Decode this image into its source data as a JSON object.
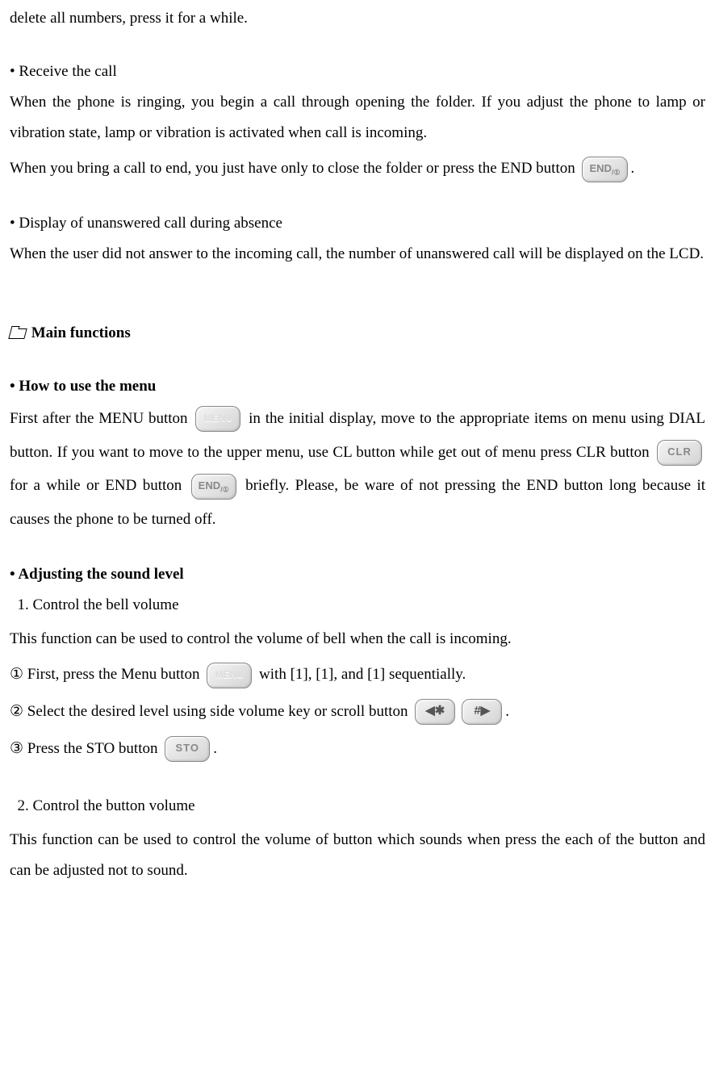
{
  "intro_delete": "delete all numbers, press it for a while.",
  "receive": {
    "head": "• Receive the call",
    "p1": "When the phone is ringing, you begin a call through opening the folder. If you adjust the phone to lamp or vibration state, lamp or vibration is activated when call is incoming.",
    "p2a": "When you bring a call to end, you just have only to close the folder or press the END button ",
    "p2b": "."
  },
  "unanswered": {
    "head": "• Display of unanswered call during absence",
    "p1": "When the user did not answer to the incoming call, the number of unanswered call will be displayed on the LCD."
  },
  "main_functions_head": " Main functions",
  "menu": {
    "head": "• How to use the menu",
    "p1a": "First after the MENU button ",
    "p1b": " in the initial display, move to the appropriate items on menu using DIAL button. If you want to move to the upper menu, use CL    button     while get out of menu press CLR button ",
    "p1c": " for a while or END button ",
    "p1d": " briefly.   Please, be ware of not pressing the END button long because it causes the phone to be turned off."
  },
  "sound": {
    "head": "• Adjusting the sound level",
    "s1_head": "  1. Control the bell volume",
    "s1_p1": "This function can be used to control the volume of bell when the call is incoming.",
    "step1a": " First, press the Menu button ",
    "step1b": " with [1], [1], and [1] sequentially.",
    "step2a": " Select the desired level using side volume key or scroll button ",
    "step2b": ".",
    "step3a": " Press the STO button ",
    "step3b": ".",
    "s2_head": "  2. Control the button volume",
    "s2_p1": "This function can be used to control the volume of button which sounds when press the each of the button and can be adjusted not to sound."
  },
  "icons": {
    "end_label": "END",
    "end_sub": "/①",
    "menu_label": "MENU",
    "clr_label": "CLR",
    "sto_label": "STO",
    "scroll_left": "◀✱",
    "scroll_right": "#▶"
  },
  "circled": {
    "c1": "①",
    "c2": "②",
    "c3": "③"
  }
}
